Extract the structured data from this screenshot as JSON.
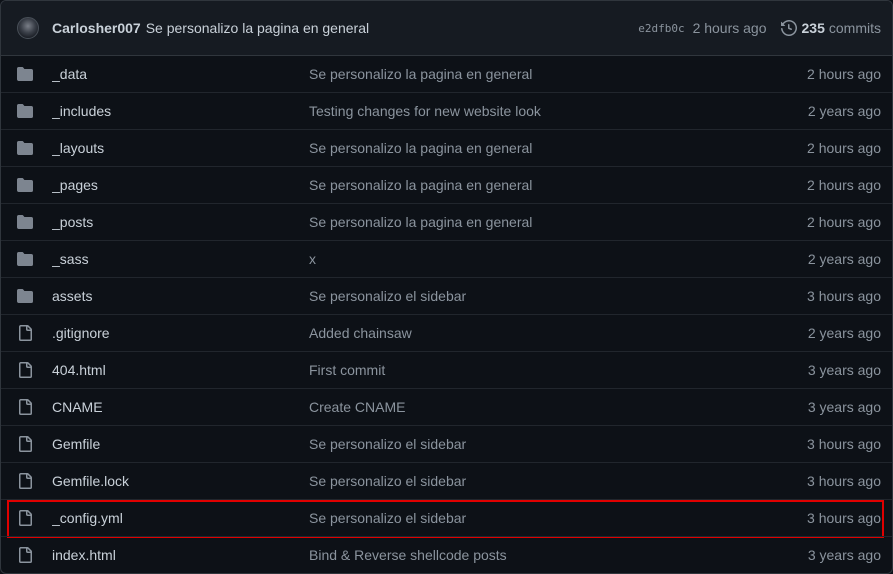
{
  "commit": {
    "author": "Carlosher007",
    "message": "Se personalizo la pagina en general",
    "sha": "e2dfb0c",
    "age": "2 hours ago",
    "count": "235",
    "count_label": "commits"
  },
  "files": [
    {
      "type": "folder",
      "name": "_data",
      "message": "Se personalizo la pagina en general",
      "age": "2 hours ago"
    },
    {
      "type": "folder",
      "name": "_includes",
      "message": "Testing changes for new website look",
      "age": "2 years ago"
    },
    {
      "type": "folder",
      "name": "_layouts",
      "message": "Se personalizo la pagina en general",
      "age": "2 hours ago"
    },
    {
      "type": "folder",
      "name": "_pages",
      "message": "Se personalizo la pagina en general",
      "age": "2 hours ago"
    },
    {
      "type": "folder",
      "name": "_posts",
      "message": "Se personalizo la pagina en general",
      "age": "2 hours ago"
    },
    {
      "type": "folder",
      "name": "_sass",
      "message": "x",
      "age": "2 years ago"
    },
    {
      "type": "folder",
      "name": "assets",
      "message": "Se personalizo el sidebar",
      "age": "3 hours ago"
    },
    {
      "type": "file",
      "name": ".gitignore",
      "message": "Added chainsaw",
      "age": "2 years ago"
    },
    {
      "type": "file",
      "name": "404.html",
      "message": "First commit",
      "age": "3 years ago"
    },
    {
      "type": "file",
      "name": "CNAME",
      "message": "Create CNAME",
      "age": "3 years ago"
    },
    {
      "type": "file",
      "name": "Gemfile",
      "message": "Se personalizo el sidebar",
      "age": "3 hours ago"
    },
    {
      "type": "file",
      "name": "Gemfile.lock",
      "message": "Se personalizo el sidebar",
      "age": "3 hours ago"
    },
    {
      "type": "file",
      "name": "_config.yml",
      "message": "Se personalizo el sidebar",
      "age": "3 hours ago",
      "highlighted": true
    },
    {
      "type": "file",
      "name": "index.html",
      "message": "Bind & Reverse shellcode posts",
      "age": "3 years ago"
    }
  ],
  "colors": {
    "background": "#0d1117",
    "header_bg": "#161b22",
    "folder_icon": "#7d8590",
    "highlight_border": "#e00000"
  }
}
